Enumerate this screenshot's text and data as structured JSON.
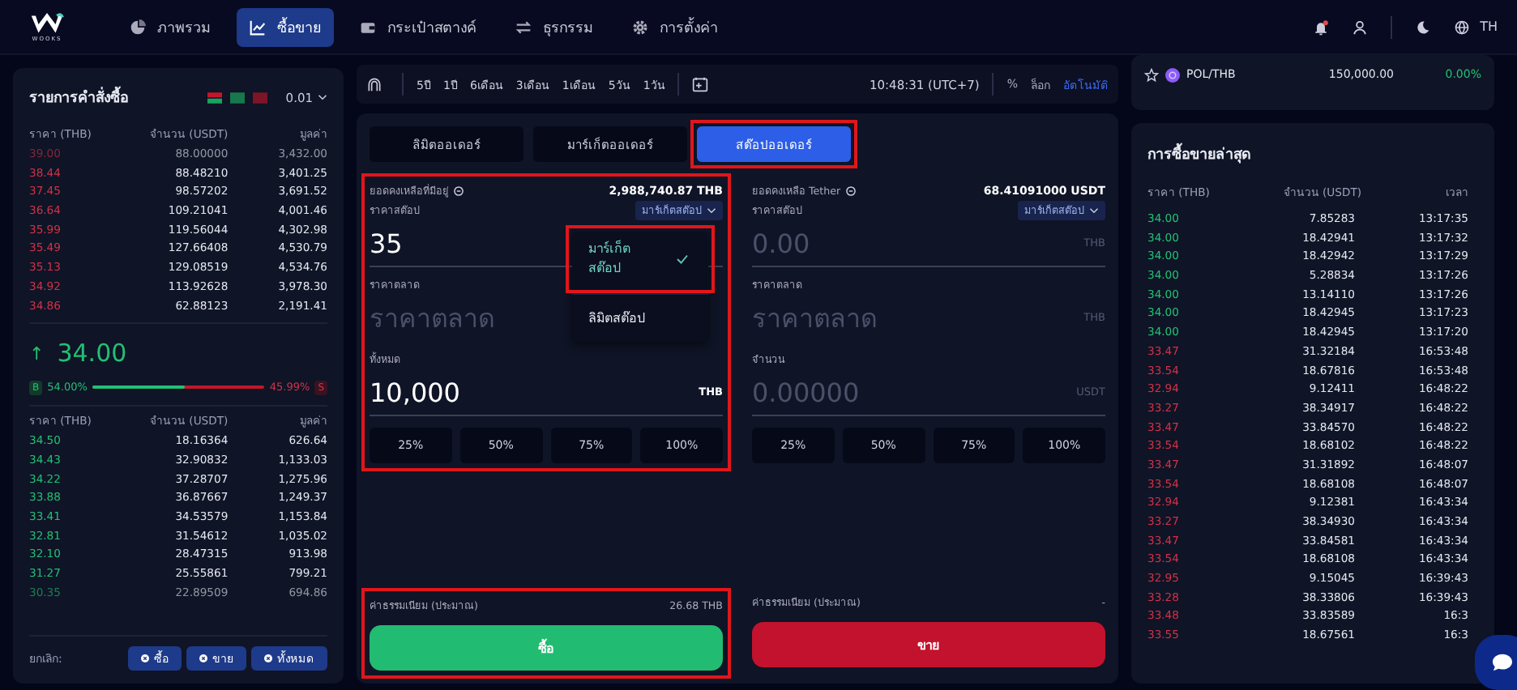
{
  "nav": {
    "logo_text": "WOOKS",
    "items": [
      {
        "label": "ภาพรวม",
        "selected": false
      },
      {
        "label": "ซื้อขาย",
        "selected": true
      },
      {
        "label": "กระเป๋าสตางค์",
        "selected": false
      },
      {
        "label": "ธุรกรรม",
        "selected": false
      },
      {
        "label": "การตั้งค่า",
        "selected": false
      }
    ],
    "language": "TH"
  },
  "order_book": {
    "title": "รายการคำสั่งซื้อ",
    "precision": "0.01",
    "columns": [
      "ราคา (THB)",
      "จำนวน (USDT)",
      "มูลค่า"
    ],
    "asks": [
      {
        "price": "39.00",
        "amount": "88.00000",
        "value": "3,432.00",
        "faded": true
      },
      {
        "price": "38.44",
        "amount": "88.48210",
        "value": "3,401.25",
        "faded": false
      },
      {
        "price": "37.45",
        "amount": "98.57202",
        "value": "3,691.52",
        "faded": false
      },
      {
        "price": "36.64",
        "amount": "109.21041",
        "value": "4,001.46",
        "faded": false
      },
      {
        "price": "35.99",
        "amount": "119.56044",
        "value": "4,302.98",
        "faded": false
      },
      {
        "price": "35.49",
        "amount": "127.66408",
        "value": "4,530.79",
        "faded": false
      },
      {
        "price": "35.13",
        "amount": "129.08519",
        "value": "4,534.76",
        "faded": false
      },
      {
        "price": "34.92",
        "amount": "113.92628",
        "value": "3,978.30",
        "faded": false
      },
      {
        "price": "34.86",
        "amount": "62.88123",
        "value": "2,191.41",
        "faded": false
      }
    ],
    "last_price": {
      "arrow": "↑",
      "value": "34.00"
    },
    "ratio": {
      "buy_tag": "B",
      "buy": "54.00%",
      "sell": "45.99%",
      "sell_tag": "S",
      "level": 0.54
    },
    "bid_columns": [
      "ราคา (THB)",
      "จำนวน (USDT)",
      "มูลค่า"
    ],
    "bids": [
      {
        "price": "34.50",
        "amount": "18.16364",
        "value": "626.64",
        "faded": false
      },
      {
        "price": "34.43",
        "amount": "32.90832",
        "value": "1,133.03",
        "faded": false
      },
      {
        "price": "34.22",
        "amount": "37.28707",
        "value": "1,275.96",
        "faded": false
      },
      {
        "price": "33.88",
        "amount": "36.87667",
        "value": "1,249.37",
        "faded": false
      },
      {
        "price": "33.41",
        "amount": "34.53579",
        "value": "1,153.84",
        "faded": false
      },
      {
        "price": "32.81",
        "amount": "31.54612",
        "value": "1,035.02",
        "faded": false
      },
      {
        "price": "32.10",
        "amount": "28.47315",
        "value": "913.98",
        "faded": false
      },
      {
        "price": "31.27",
        "amount": "25.55861",
        "value": "799.21",
        "faded": false
      },
      {
        "price": "30.35",
        "amount": "22.89509",
        "value": "694.86",
        "faded": true
      }
    ],
    "cancel_label": "ยกเลิก:",
    "cancel_buttons": [
      "ซื้อ",
      "ขาย",
      "ทั้งหมด"
    ]
  },
  "chart_toolbar": {
    "ranges": [
      "5ปี",
      "1ปี",
      "6เดือน",
      "3เดือน",
      "1เดือน",
      "5วัน",
      "1วัน"
    ],
    "time": "10:48:31 (UTC+7)",
    "scales": [
      {
        "label": "%",
        "selected": false
      },
      {
        "label": "ล็อก",
        "selected": false
      },
      {
        "label": "อัตโนมัติ",
        "selected": true
      }
    ]
  },
  "order_tabs": [
    {
      "label": "ลิมิตออเดอร์",
      "selected": false,
      "annotated": false
    },
    {
      "label": "มาร์เก็ตออเดอร์",
      "selected": false,
      "annotated": false
    },
    {
      "label": "สต๊อปออเดอร์",
      "selected": true,
      "annotated": true
    }
  ],
  "buy_form": {
    "annotated": true,
    "balance_label": "ยอดคงเหลือที่มีอยู่",
    "balance": "2,988,740.87 THB",
    "stop_label": "ราคาสต๊อป",
    "order_type": "มาร์เก็ตสต๊อป",
    "stop_value": "35",
    "market_label": "ราคาตลาด",
    "market_placeholder": "ราคาตลาด",
    "total_label": "ทั้งหมด",
    "total_value": "10,000",
    "total_unit": "THB",
    "percents": [
      "25%",
      "50%",
      "75%",
      "100%"
    ]
  },
  "order_type_menu": [
    {
      "label": "มาร์เก็ตสต๊อป",
      "selected": true,
      "annotated": true
    },
    {
      "label": "ลิมิตสต๊อป",
      "selected": false,
      "annotated": false
    }
  ],
  "sell_form": {
    "balance_label": "ยอดคงเหลือ Tether",
    "balance": "68.41091000 USDT",
    "stop_label": "ราคาสต๊อป",
    "order_type": "มาร์เก็ตสต๊อป",
    "stop_placeholder": "0.00",
    "stop_unit": "THB",
    "market_label": "ราคาตลาด",
    "market_placeholder": "ราคาตลาด",
    "market_unit": "THB",
    "amount_label": "จำนวน",
    "amount_placeholder": "0.00000",
    "amount_unit": "USDT",
    "percents": [
      "25%",
      "50%",
      "75%",
      "100%"
    ]
  },
  "buy_footer": {
    "annotated": true,
    "fee_label": "ค่าธรรมเนียม (ประมาณ)",
    "fee": "26.68 THB",
    "button": "ซื้อ"
  },
  "sell_footer": {
    "fee_label": "ค่าธรรมเนียม (ประมาณ)",
    "fee": "-",
    "button": "ขาย"
  },
  "watchlist": [
    {
      "pair": "POL/THB",
      "price": "150,000.00",
      "change": "0.00%"
    }
  ],
  "recent_trades": {
    "title": "การซื้อขายล่าสุด",
    "columns": [
      "ราคา (THB)",
      "จำนวน (USDT)",
      "เวลา"
    ],
    "rows": [
      {
        "price": "34.00",
        "amount": "7.85283",
        "time": "13:17:35",
        "color": "#22c074"
      },
      {
        "price": "34.00",
        "amount": "18.42941",
        "time": "13:17:32",
        "color": "#22c074"
      },
      {
        "price": "34.00",
        "amount": "18.42942",
        "time": "13:17:29",
        "color": "#22c074"
      },
      {
        "price": "34.00",
        "amount": "5.28834",
        "time": "13:17:26",
        "color": "#22c074"
      },
      {
        "price": "34.00",
        "amount": "13.14110",
        "time": "13:17:26",
        "color": "#22c074"
      },
      {
        "price": "34.00",
        "amount": "18.42945",
        "time": "13:17:23",
        "color": "#22c074"
      },
      {
        "price": "34.00",
        "amount": "18.42945",
        "time": "13:17:20",
        "color": "#22c074"
      },
      {
        "price": "33.47",
        "amount": "31.32184",
        "time": "16:53:48",
        "color": "#d13247"
      },
      {
        "price": "33.54",
        "amount": "18.67816",
        "time": "16:53:48",
        "color": "#d13247"
      },
      {
        "price": "32.94",
        "amount": "9.12411",
        "time": "16:48:22",
        "color": "#d13247"
      },
      {
        "price": "33.27",
        "amount": "38.34917",
        "time": "16:48:22",
        "color": "#d13247"
      },
      {
        "price": "33.47",
        "amount": "33.84570",
        "time": "16:48:22",
        "color": "#d13247"
      },
      {
        "price": "33.54",
        "amount": "18.68102",
        "time": "16:48:22",
        "color": "#d13247"
      },
      {
        "price": "33.47",
        "amount": "31.31892",
        "time": "16:48:07",
        "color": "#d13247"
      },
      {
        "price": "33.54",
        "amount": "18.68108",
        "time": "16:48:07",
        "color": "#d13247"
      },
      {
        "price": "32.94",
        "amount": "9.12381",
        "time": "16:43:34",
        "color": "#d13247"
      },
      {
        "price": "33.27",
        "amount": "38.34930",
        "time": "16:43:34",
        "color": "#d13247"
      },
      {
        "price": "33.47",
        "amount": "33.84581",
        "time": "16:43:34",
        "color": "#d13247"
      },
      {
        "price": "33.54",
        "amount": "18.68108",
        "time": "16:43:34",
        "color": "#d13247"
      },
      {
        "price": "32.95",
        "amount": "9.15045",
        "time": "16:39:43",
        "color": "#d13247"
      },
      {
        "price": "33.28",
        "amount": "38.33806",
        "time": "16:39:43",
        "color": "#d13247"
      },
      {
        "price": "33.48",
        "amount": "33.83589",
        "time": "16:3",
        "color": "#d13247"
      },
      {
        "price": "33.55",
        "amount": "18.67561",
        "time": "16:3",
        "color": "#d13247"
      }
    ]
  }
}
